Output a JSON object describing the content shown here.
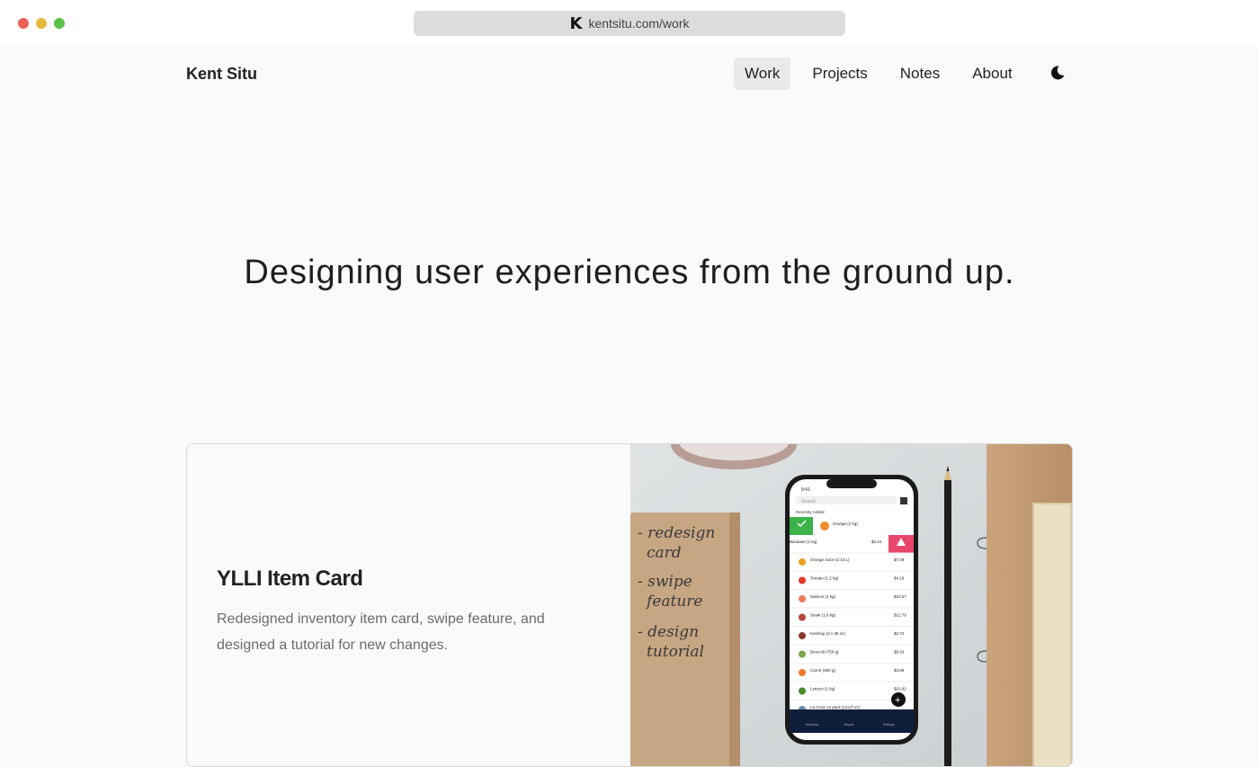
{
  "browser": {
    "favicon": "K",
    "url": "kentsitu.com/work"
  },
  "header": {
    "brand": "Kent Situ",
    "nav": [
      {
        "label": "Work",
        "active": true
      },
      {
        "label": "Projects",
        "active": false
      },
      {
        "label": "Notes",
        "active": false
      },
      {
        "label": "About",
        "active": false
      }
    ],
    "theme_toggle_icon": "moon-icon"
  },
  "hero": {
    "headline": "Designing user experiences from the ground up."
  },
  "project": {
    "title": "YLLI Item Card",
    "description": "Redesigned inventory item card, swipe feature, and designed a tutorial for new changes.",
    "image": {
      "note_lines": [
        "- redesign",
        "card",
        "- swipe",
        "feature",
        "- design",
        "tutorial"
      ],
      "phone": {
        "search": "Search",
        "sort": "Recently Added",
        "items": [
          {
            "name": "Orange (2 kg)",
            "price": ""
          },
          {
            "name": "Bananas (1 kg)",
            "price": "$3.24"
          },
          {
            "name": "Orange Juice (2.23 L)",
            "price": "$7.49"
          },
          {
            "name": "Tomato (1.2 kg)",
            "price": "$4.19"
          },
          {
            "name": "Salmon (1 kg)",
            "price": "$10.67"
          },
          {
            "name": "Steak (1.6 kg)",
            "price": "$21.79"
          },
          {
            "name": "Ketchup (2 x 38 oz)",
            "price": "$3.72"
          },
          {
            "name": "Broccoli (750 g)",
            "price": "$5.03"
          },
          {
            "name": "Carrot (800 g)",
            "price": "$3.89"
          },
          {
            "name": "Lettuce (1 kg)",
            "price": "$10.82"
          },
          {
            "name": "La Croix 12 pack (144 fl oz)",
            "price": ""
          }
        ],
        "tabs": [
          "Inventory",
          "Report",
          "Settings"
        ]
      }
    }
  },
  "colors": {
    "accent_green": "#3bb34a",
    "accent_red": "#e8466a",
    "card_border": "#d9d9d9",
    "page_bg": "#fafafa"
  }
}
